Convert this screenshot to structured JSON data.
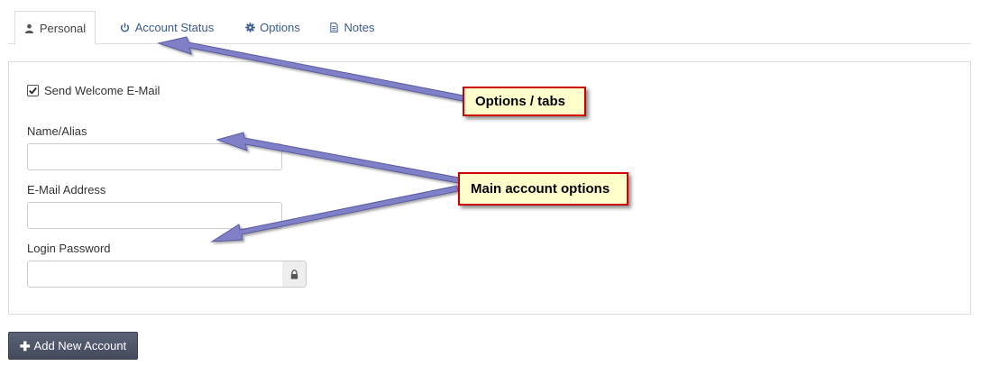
{
  "tabs": [
    {
      "label": "Personal",
      "icon": "user-icon",
      "active": true
    },
    {
      "label": "Account Status",
      "icon": "power-icon",
      "active": false
    },
    {
      "label": "Options",
      "icon": "gear-icon",
      "active": false
    },
    {
      "label": "Notes",
      "icon": "document-icon",
      "active": false
    }
  ],
  "form": {
    "welcome_checkbox": {
      "label": "Send Welcome E-Mail",
      "checked": true
    },
    "name_alias": {
      "label": "Name/Alias",
      "value": ""
    },
    "email": {
      "label": "E-Mail Address",
      "value": ""
    },
    "password": {
      "label": "Login Password",
      "value": "",
      "addon_icon": "lock-icon"
    }
  },
  "add_button": {
    "label": "Add New Account",
    "icon": "plus-icon"
  },
  "annotations": {
    "tabs_callout": "Options / tabs",
    "main_callout": "Main account options"
  },
  "colors": {
    "callout_fill": "#ffffcc",
    "callout_border": "#cc0000",
    "arrow": "#8080c8",
    "button": "#4b5264",
    "tab_link": "#3a5a8c"
  }
}
